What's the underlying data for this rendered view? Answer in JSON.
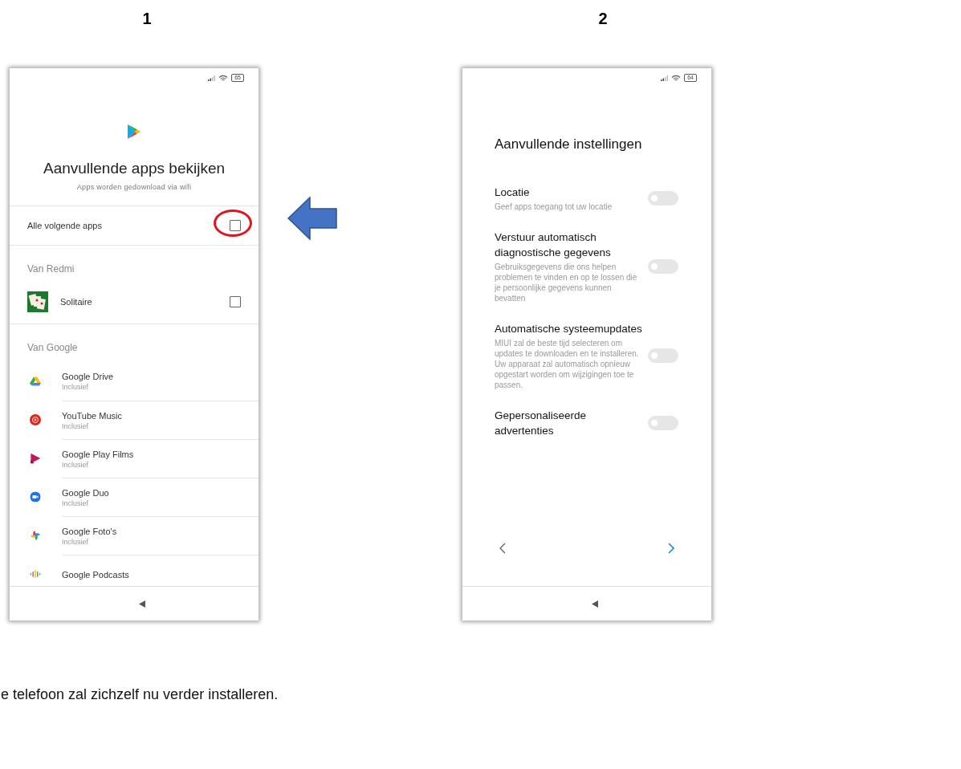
{
  "steps": [
    {
      "number": "1",
      "battery": "65",
      "kind": "apps",
      "title": "Aanvullende apps bekijken",
      "subtitle": "Apps worden gedownload via wifi",
      "select_all": {
        "label": "Alle volgende apps",
        "checked": false,
        "highlighted": true
      },
      "sections": [
        {
          "title": "Van Redmi",
          "apps": [
            {
              "name": "Solitaire",
              "kind": "solitaire",
              "checked": false
            }
          ]
        },
        {
          "title": "Van Google",
          "apps": [
            {
              "name": "Google Drive",
              "sub": "Inclusief",
              "kind": "drive"
            },
            {
              "name": "YouTube Music",
              "sub": "Inclusief",
              "kind": "music"
            },
            {
              "name": "Google Play Films",
              "sub": "Inclusief",
              "kind": "films"
            },
            {
              "name": "Google Duo",
              "sub": "Inclusief",
              "kind": "duo"
            },
            {
              "name": "Google Foto's",
              "sub": "Inclusief",
              "kind": "photos"
            },
            {
              "name": "Google Podcasts",
              "kind": "podcasts"
            }
          ]
        }
      ]
    },
    {
      "number": "2",
      "battery": "64",
      "kind": "settings",
      "title": "Aanvullende instellingen",
      "settings": [
        {
          "title": "Locatie",
          "description": "Geef apps toegang tot uw locatie",
          "on": false
        },
        {
          "title": "Verstuur automatisch diagnostische gegevens",
          "description": "Gebruiksgegevens die ons helpen problemen te vinden en op te lossen die je persoonlijke gegevens kunnen bevatten",
          "on": false
        },
        {
          "title": "Automatische systeemupdates",
          "description": "MIUI zal de beste tijd selecteren om updates te downloaden en te installeren. Uw apparaat zal automatisch opnieuw opgestart worden om wijzigingen toe te passen.",
          "on": false
        },
        {
          "title": "Gepersonaliseerde advertenties",
          "on": false
        }
      ]
    }
  ],
  "caption": "e telefoon zal zichzelf nu verder installeren."
}
